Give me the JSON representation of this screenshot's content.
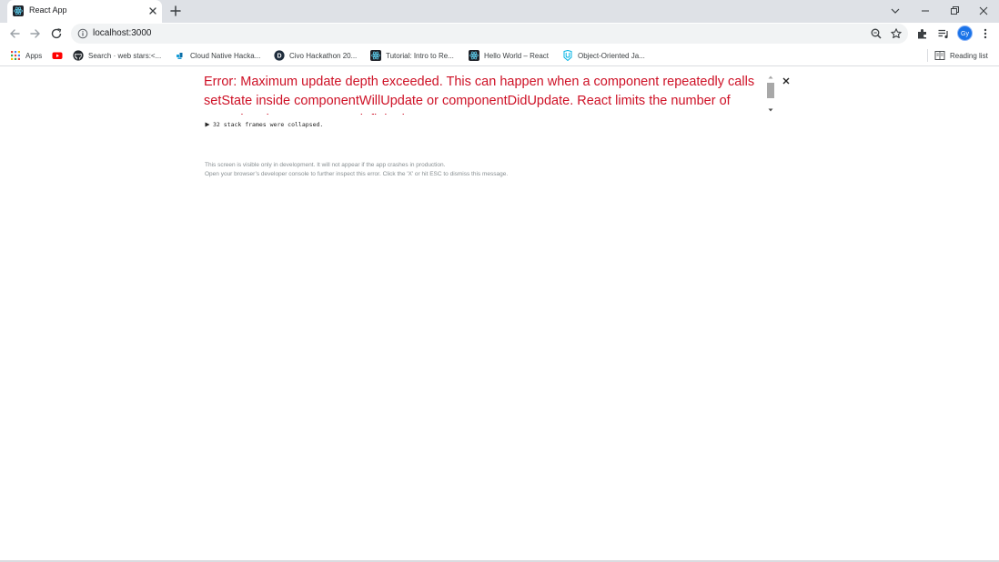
{
  "tab": {
    "title": "React App",
    "favicon": "react-icon"
  },
  "toolbar": {
    "url": "localhost:3000",
    "avatar_initials": "Gy"
  },
  "bookmarks": {
    "items": [
      {
        "label": "Apps",
        "icon": "apps-grid-icon"
      },
      {
        "label": "",
        "icon": "youtube-icon"
      },
      {
        "label": "Search · web stars:<...",
        "icon": "github-icon"
      },
      {
        "label": "Cloud Native Hacka...",
        "icon": "cloud-icon"
      },
      {
        "label": "Civo Hackathon 20...",
        "icon": "civo-icon"
      },
      {
        "label": "Tutorial: Intro to Re...",
        "icon": "react-icon"
      },
      {
        "label": "Hello World – React",
        "icon": "react-icon"
      },
      {
        "label": "Object-Oriented Ja...",
        "icon": "udacity-icon"
      }
    ],
    "reading_list": "Reading list"
  },
  "error_overlay": {
    "message": "Error: Maximum update depth exceeded. This can happen when a component repeatedly calls setState inside componentWillUpdate or componentDidUpdate. React limits the number of nested updates to prevent infinite loops.",
    "collapsed_frames": "32 stack frames were collapsed.",
    "footer_line1": "This screen is visible only in development. It will not appear if the app crashes in production.",
    "footer_line2": "Open your browser’s developer console to further inspect this error.  Click the 'X' or hit ESC to dismiss this message."
  },
  "colors": {
    "error_red": "#ce1126",
    "tab_strip": "#dee1e6",
    "omnibox": "#f1f3f4",
    "accent_blue": "#1a73e8"
  }
}
